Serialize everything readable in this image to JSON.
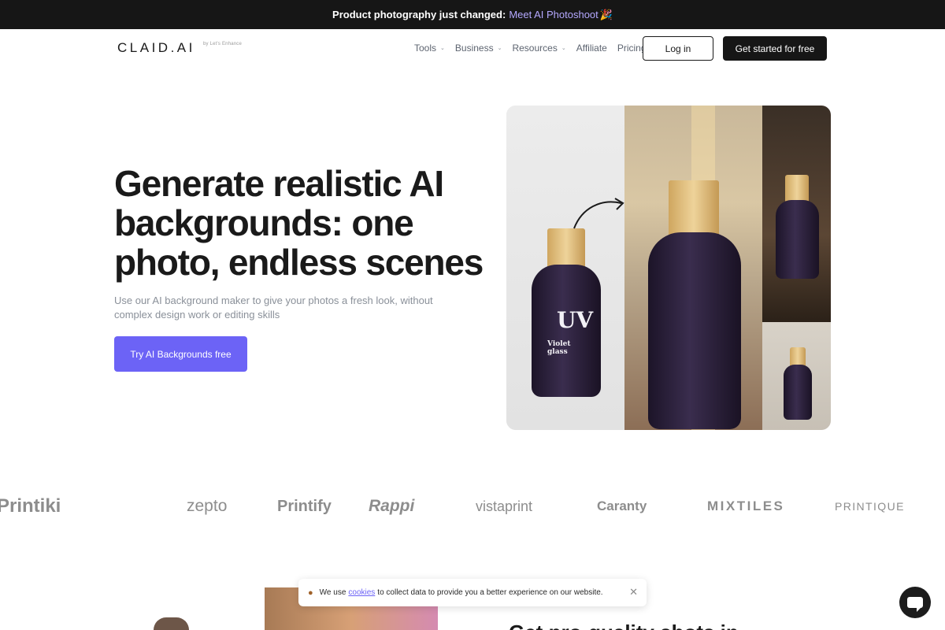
{
  "announcement": {
    "text": "Product photography just changed:",
    "link": "Meet AI Photoshoot",
    "emoji": "🎉"
  },
  "header": {
    "logo": "CLAID.AI",
    "logo_tagline": "by Let's Enhance",
    "nav": [
      {
        "label": "Tools",
        "has_dropdown": true
      },
      {
        "label": "Business",
        "has_dropdown": true
      },
      {
        "label": "Resources",
        "has_dropdown": true
      },
      {
        "label": "Affiliate",
        "has_dropdown": false
      },
      {
        "label": "Pricing",
        "has_dropdown": false
      }
    ],
    "login_label": "Log in",
    "cta_label": "Get started for free"
  },
  "hero": {
    "title": "Generate realistic AI backgrounds: one photo, endless scenes",
    "subtitle": "Use our AI background maker to give your photos a fresh look, without complex design work or editing skills",
    "cta_label": "Try AI Backgrounds free",
    "product": {
      "brand_mark": "UV",
      "name": "Violet glass"
    }
  },
  "logos": [
    "Printiki",
    "zepto",
    "Printify",
    "Rappi",
    "vistaprint",
    "Caranty",
    "MIXTILES",
    "PRINTIQUE"
  ],
  "section": {
    "heading_partial": "Get pro-quality shots in"
  },
  "cookie_banner": {
    "text_before": "We use",
    "link": "cookies",
    "text_after": "to collect data to provide you a better experience on our website."
  },
  "colors": {
    "accent": "#6c63f6",
    "dark": "#161616",
    "announce_link": "#b5a9ff"
  }
}
